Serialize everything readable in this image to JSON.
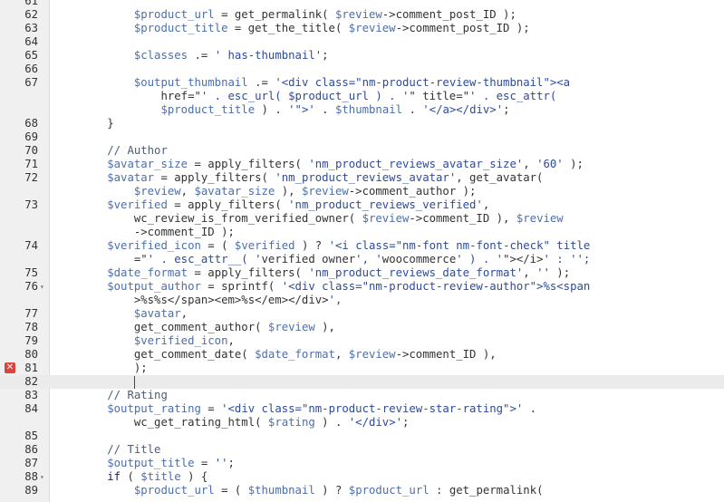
{
  "editor": {
    "error_icon": "error-x-icon",
    "fold_icon": "chevron-down-icon",
    "lines": [
      {
        "n": "61",
        "text": ""
      },
      {
        "n": "62",
        "text": "            $product_url = get_permalink( $review->comment_post_ID );"
      },
      {
        "n": "63",
        "text": "            $product_title = get_the_title( $review->comment_post_ID );"
      },
      {
        "n": "64",
        "text": ""
      },
      {
        "n": "65",
        "text": "            $classes .= ' has-thumbnail';"
      },
      {
        "n": "66",
        "text": ""
      },
      {
        "n": "67",
        "text": "            $output_thumbnail .= '<div class=\"nm-product-review-thumbnail\"><a"
      },
      {
        "n": "",
        "text": "                href=\"' . esc_url( $product_url ) . '\" title=\"' . esc_attr("
      },
      {
        "n": "",
        "text": "                $product_title ) . '\">' . $thumbnail . '</a></div>';"
      },
      {
        "n": "68",
        "text": "        }"
      },
      {
        "n": "69",
        "text": ""
      },
      {
        "n": "70",
        "text": "        // Author"
      },
      {
        "n": "71",
        "text": "        $avatar_size = apply_filters( 'nm_product_reviews_avatar_size', '60' );"
      },
      {
        "n": "72",
        "text": "        $avatar = apply_filters( 'nm_product_reviews_avatar', get_avatar("
      },
      {
        "n": "",
        "text": "            $review, $avatar_size ), $review->comment_author );"
      },
      {
        "n": "73",
        "text": "        $verified = apply_filters( 'nm_product_reviews_verified',"
      },
      {
        "n": "",
        "text": "            wc_review_is_from_verified_owner( $review->comment_ID ), $review"
      },
      {
        "n": "",
        "text": "            ->comment_ID );"
      },
      {
        "n": "74",
        "text": "        $verified_icon = ( $verified ) ? '<i class=\"nm-font nm-font-check\" title"
      },
      {
        "n": "",
        "text": "            =\"' . esc_attr__( 'verified owner', 'woocommerce' ) . '\"></i>' : '';"
      },
      {
        "n": "75",
        "text": "        $date_format = apply_filters( 'nm_product_reviews_date_format', '' );"
      },
      {
        "n": "76",
        "text": "        $output_author = sprintf( '<div class=\"nm-product-review-author\">%s<span",
        "fold": true
      },
      {
        "n": "",
        "text": "            >%s%s</span><em>%s</em></div>',"
      },
      {
        "n": "77",
        "text": "            $avatar,"
      },
      {
        "n": "78",
        "text": "            get_comment_author( $review ),"
      },
      {
        "n": "79",
        "text": "            $verified_icon,"
      },
      {
        "n": "80",
        "text": "            get_comment_date( $date_format, $review->comment_ID ),"
      },
      {
        "n": "81",
        "text": "            );",
        "error": true
      },
      {
        "n": "82",
        "text": "            ",
        "active": true,
        "cursor": true
      },
      {
        "n": "83",
        "text": "        // Rating"
      },
      {
        "n": "84",
        "text": "        $output_rating = '<div class=\"nm-product-review-star-rating\">' ."
      },
      {
        "n": "",
        "text": "            wc_get_rating_html( $rating ) . '</div>';"
      },
      {
        "n": "85",
        "text": ""
      },
      {
        "n": "86",
        "text": "        // Title"
      },
      {
        "n": "87",
        "text": "        $output_title = '';"
      },
      {
        "n": "88",
        "text": "        if ( $title ) {",
        "fold": true
      },
      {
        "n": "89",
        "text": "            $product_url = ( $thumbnail ) ? $product_url : get_permalink("
      }
    ]
  }
}
